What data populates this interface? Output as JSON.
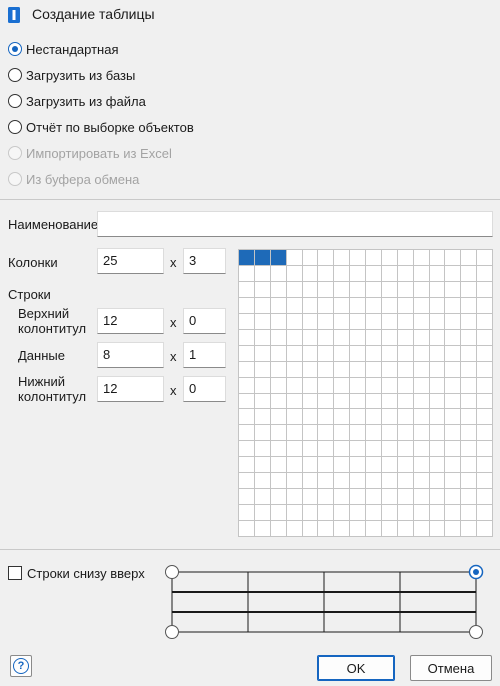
{
  "window": {
    "title": "Создание таблицы"
  },
  "source_options": [
    {
      "label": "Нестандартная",
      "checked": true,
      "disabled": false
    },
    {
      "label": "Загрузить из базы",
      "checked": false,
      "disabled": false
    },
    {
      "label": "Загрузить из файла",
      "checked": false,
      "disabled": false
    },
    {
      "label": "Отчёт по выборке объектов",
      "checked": false,
      "disabled": false
    },
    {
      "label": "Импортировать из Excel",
      "checked": false,
      "disabled": true
    },
    {
      "label": "Из буфера обмена",
      "checked": false,
      "disabled": true
    }
  ],
  "form": {
    "name_label": "Наименование",
    "name_value": "",
    "columns_label": "Колонки",
    "columns_count": "25",
    "columns_width": "3",
    "rows_label": "Строки",
    "header_label_line1": "Верхний",
    "header_label_line2": "колонтитул",
    "header_rows": "12",
    "header_height": "0",
    "data_label": "Данные",
    "data_rows": "8",
    "data_height": "1",
    "footer_label_line1": "Нижний",
    "footer_label_line2": "колонтитул",
    "footer_rows": "12",
    "footer_height": "0",
    "times_sign": "x"
  },
  "grid_picker": {
    "columns": 16,
    "rows": 18,
    "selected_columns": 3,
    "selected_rows": 1,
    "selected_color": "#1e6ab8"
  },
  "bottom_up": {
    "label": "Строки снизу вверх",
    "checked": false
  },
  "buttons": {
    "ok": "OK",
    "cancel": "Отмена",
    "help_glyph": "?"
  },
  "colors": {
    "accent": "#1565c0",
    "background": "#f0f0f0"
  }
}
